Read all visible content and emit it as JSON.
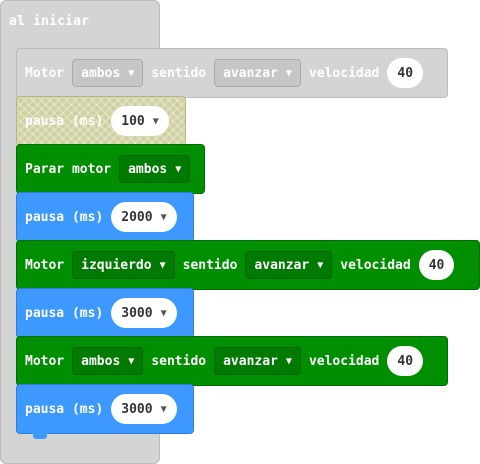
{
  "event": {
    "title": "al iniciar"
  },
  "blocks": {
    "motor1": {
      "label": "Motor",
      "side": "ambos",
      "direction_label": "sentido",
      "direction": "avanzar",
      "speed_label": "velocidad",
      "speed": "40"
    },
    "pause1": {
      "label": "pausa (ms)",
      "value": "100"
    },
    "stop": {
      "label": "Parar motor",
      "side": "ambos"
    },
    "pause2": {
      "label": "pausa (ms)",
      "value": "2000"
    },
    "motor2": {
      "label": "Motor",
      "side": "izquierdo",
      "direction_label": "sentido",
      "direction": "avanzar",
      "speed_label": "velocidad",
      "speed": "40"
    },
    "pause3": {
      "label": "pausa (ms)",
      "value": "3000"
    },
    "motor3": {
      "label": "Motor",
      "side": "ambos",
      "direction_label": "sentido",
      "direction": "avanzar",
      "speed_label": "velocidad",
      "speed": "40"
    },
    "pause4": {
      "label": "pausa (ms)",
      "value": "3000"
    }
  },
  "icons": {
    "dropdown": "caret-down-icon",
    "caret_glyph": "▼"
  },
  "colors": {
    "motor": "#008f00",
    "pause": "#3d98ff",
    "disabled": "#d4d4d4",
    "event": "#d4d4d4"
  }
}
